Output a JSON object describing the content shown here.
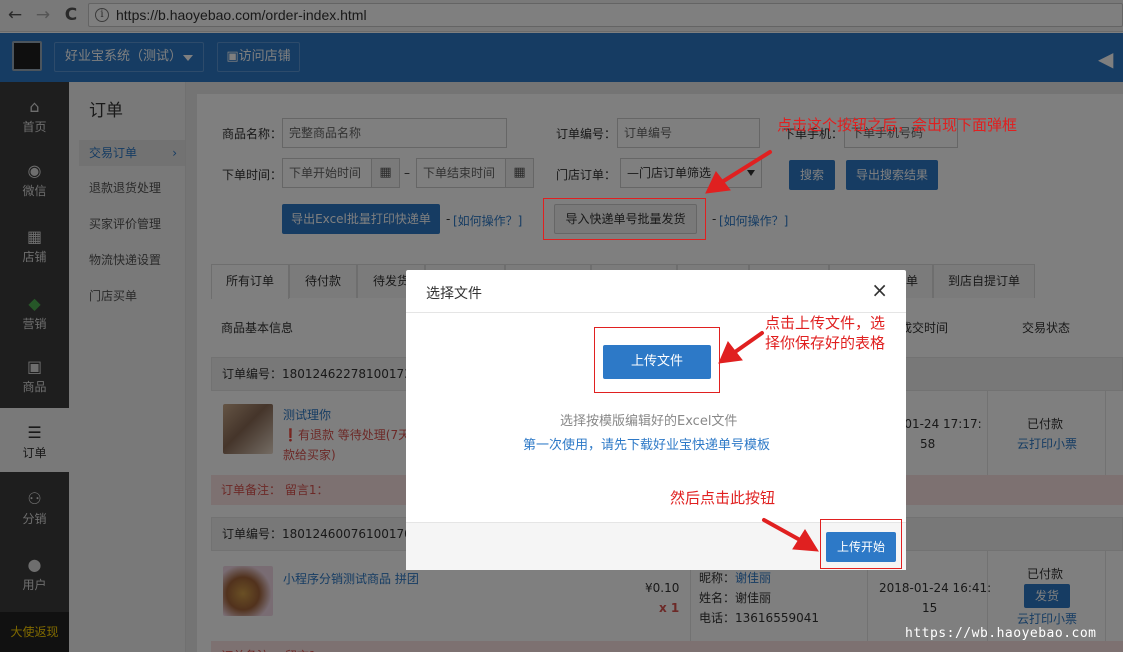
{
  "browser": {
    "url": "https://b.haoyebao.com/order-index.html",
    "back": "←",
    "forward": "→",
    "reload": "C",
    "info": "i"
  },
  "header": {
    "system_label": "好业宝系统（测试）",
    "visit_store": "▣访问店铺",
    "speaker": "◀"
  },
  "leftnav": [
    {
      "icon": "⌂",
      "label": "首页"
    },
    {
      "icon": "◉",
      "label": "微信"
    },
    {
      "icon": "▦",
      "label": "店铺"
    },
    {
      "icon": "◆",
      "label": "营销"
    },
    {
      "icon": "▣",
      "label": "商品"
    },
    {
      "icon": "☰",
      "label": "订单"
    },
    {
      "icon": "⚇",
      "label": "分销"
    },
    {
      "icon": "●",
      "label": "用户"
    }
  ],
  "leftnav_footer": "大使返现",
  "subnav": {
    "title": "订单",
    "items": [
      "交易订单",
      "退款退货处理",
      "买家评价管理",
      "物流快递设置",
      "门店买单"
    ],
    "chevron": "›"
  },
  "filters": {
    "product_name_label": "商品名称：",
    "product_name_placeholder": "完整商品名称",
    "order_no_label": "订单编号：",
    "order_no_placeholder": "订单编号",
    "phone_label": "下单手机：",
    "phone_placeholder": "下单手机号码",
    "time_label": "下单时间：",
    "start_placeholder": "下单开始时间",
    "end_placeholder": "下单结束时间",
    "dash": "–",
    "store_label": "门店订单：",
    "store_select": "—门店订单筛选",
    "search_btn": "搜索",
    "export_search_btn": "导出搜索结果",
    "export_excel_btn": "导出Excel批量打印快递单",
    "how_link_1": "[如何操作？]",
    "import_btn": "导入快递单号批量发货",
    "how_link_2": "[如何操作？]",
    "hyphen": "-",
    "cal_icon": "▦"
  },
  "tabs": [
    "所有订单",
    "待付款",
    "待发货",
    "",
    "",
    "",
    "",
    "",
    "单",
    "到店自提订单"
  ],
  "table_headers": {
    "product_info": "商品基本信息",
    "deal_time": "成交时间",
    "status": "交易状态"
  },
  "orders": [
    {
      "order_no": "订单编号：180124622781001732",
      "product": "测试理你",
      "refund_note": "有退款 等待处理(7天",
      "refund_note2": "款给买家)",
      "warn_icon": "❗",
      "time_line1": "-01-24 17:17:",
      "time_line2": "58",
      "status": "已付款",
      "print_link": "云打印小票",
      "remark": "订单备注： 留言1："
    },
    {
      "order_no": "订单编号：180124600761001702",
      "product": "小程序分销测试商品 拼团",
      "price": "¥0.10",
      "qty": "x 1",
      "nickname_label": "昵称：",
      "nickname": "谢佳丽",
      "name_label": "姓名：",
      "name": "谢佳丽",
      "phone_label": "电话：",
      "phone": "13616559041",
      "time_line1": "2018-01-24 16:41:",
      "time_line2": "15",
      "status": "已付款",
      "ship_btn": "发货",
      "print_link": "云打印小票",
      "remark": "订单备注： 留言1："
    }
  ],
  "dialog": {
    "title": "选择文件",
    "close": "×",
    "upload_btn": "上传文件",
    "hint": "选择按模版编辑好的Excel文件",
    "first_use": "第一次使用，请先下载好业宝快递单号模板",
    "start_btn": "上传开始"
  },
  "annotations": {
    "top": "点击这个按钮之后，会出现下面弹框",
    "upload_1": "点击上传文件，选",
    "upload_2": "择你保存好的表格",
    "start": "然后点击此按钮"
  },
  "watermark": "https://wb.haoyebao.com",
  "colors": {
    "brand": "#2d79c7",
    "annotation": "#e02020",
    "nav_dark": "#3c3c3c"
  }
}
